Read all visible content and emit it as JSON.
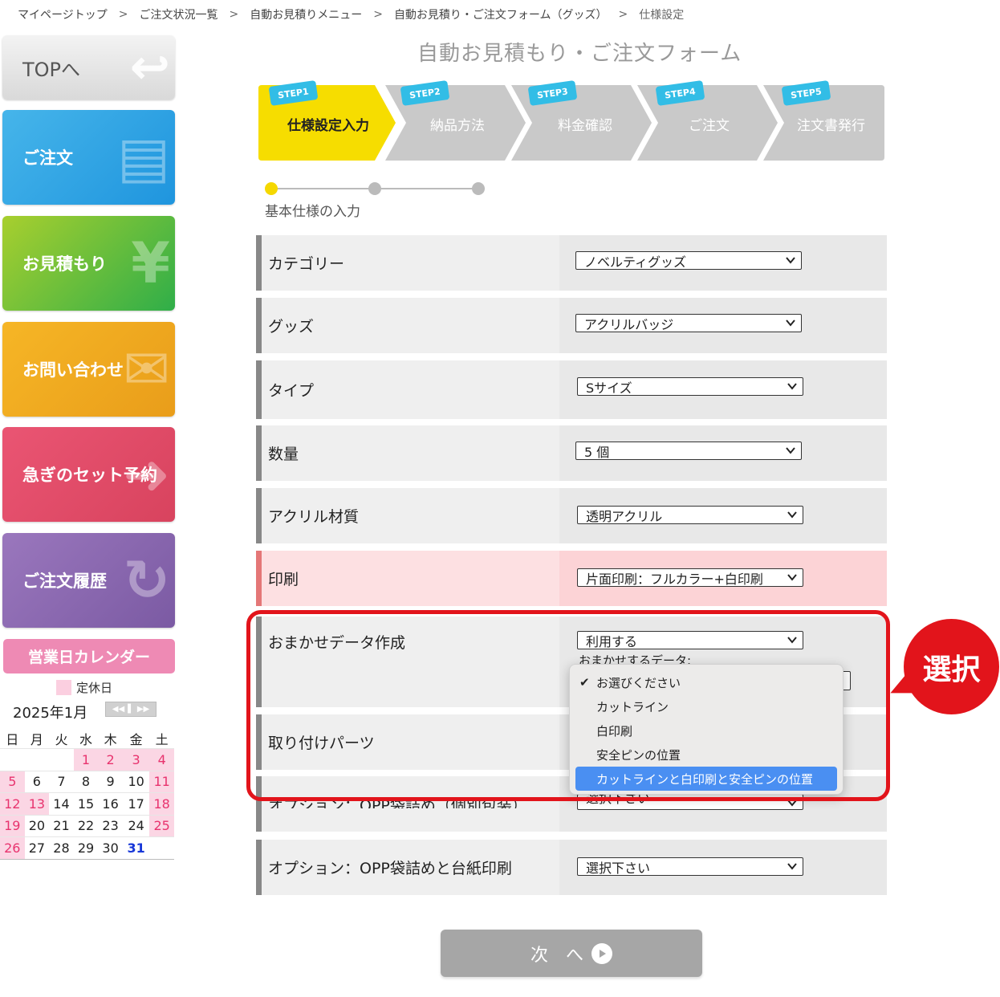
{
  "breadcrumb": {
    "items": [
      "マイページトップ",
      "ご注文状況一覧",
      "自動お見積りメニュー",
      "自動お見積り・ご注文フォーム（グッズ）",
      "仕様設定"
    ],
    "separator": ">"
  },
  "sidebar": {
    "top": "TOPへ",
    "order": "ご注文",
    "estimate": "お見積もり",
    "contact": "お問い合わせ",
    "rush": "急ぎのセット予約",
    "history": "ご注文履歴"
  },
  "calendar": {
    "title": "営業日カレンダー",
    "legend": "定休日",
    "month": "2025年1月",
    "weekdays": [
      "日",
      "月",
      "火",
      "水",
      "木",
      "金",
      "土"
    ],
    "weeks": [
      [
        "",
        "",
        "",
        "1",
        "2",
        "3",
        "4"
      ],
      [
        "5",
        "6",
        "7",
        "8",
        "9",
        "10",
        "11"
      ],
      [
        "12",
        "13",
        "14",
        "15",
        "16",
        "17",
        "18"
      ],
      [
        "19",
        "20",
        "21",
        "22",
        "23",
        "24",
        "25"
      ],
      [
        "26",
        "27",
        "28",
        "29",
        "30",
        "31",
        ""
      ]
    ],
    "closed_days": [
      "1",
      "2",
      "3",
      "4",
      "5",
      "11",
      "12",
      "13",
      "18",
      "19",
      "25",
      "26"
    ],
    "today": "31"
  },
  "main": {
    "title": "自動お見積もり・ご注文フォーム",
    "steps": [
      {
        "tag": "STEP1",
        "label": "仕様設定入力",
        "active": true
      },
      {
        "tag": "STEP2",
        "label": "納品方法",
        "active": false
      },
      {
        "tag": "STEP3",
        "label": "料金確認",
        "active": false
      },
      {
        "tag": "STEP4",
        "label": "ご注文",
        "active": false
      },
      {
        "tag": "STEP5",
        "label": "注文書発行",
        "active": false
      }
    ],
    "progress_label": "基本仕様の入力",
    "rows": {
      "category": {
        "label": "カテゴリー",
        "value": "ノベルティグッズ"
      },
      "goods": {
        "label": "グッズ",
        "value": "アクリルバッジ"
      },
      "type": {
        "label": "タイプ",
        "value": "Sサイズ"
      },
      "quantity": {
        "label": "数量",
        "value": "5 個"
      },
      "material": {
        "label": "アクリル材質",
        "value": "透明アクリル"
      },
      "print": {
        "label": "印刷",
        "value": "片面印刷：フルカラー+白印刷"
      },
      "auto_data": {
        "label": "おまかせデータ作成",
        "value": "利用する",
        "sublabel": "おまかせするデータ:"
      },
      "parts": {
        "label": "取り付けパーツ"
      },
      "opp": {
        "label": "オプション：OPP袋詰め（個別包装）",
        "value": "選択下さい"
      },
      "opp_card": {
        "label": "オプション：OPP袋詰めと台紙印刷",
        "value": "選択下さい"
      }
    },
    "dropdown_options": [
      {
        "label": "お選びください",
        "checked": true
      },
      {
        "label": "カットライン"
      },
      {
        "label": "白印刷"
      },
      {
        "label": "安全ピンの位置"
      },
      {
        "label": "カットラインと白印刷と安全ピンの位置",
        "highlighted": true
      }
    ],
    "callout": "選択",
    "next_button": "次　へ"
  }
}
